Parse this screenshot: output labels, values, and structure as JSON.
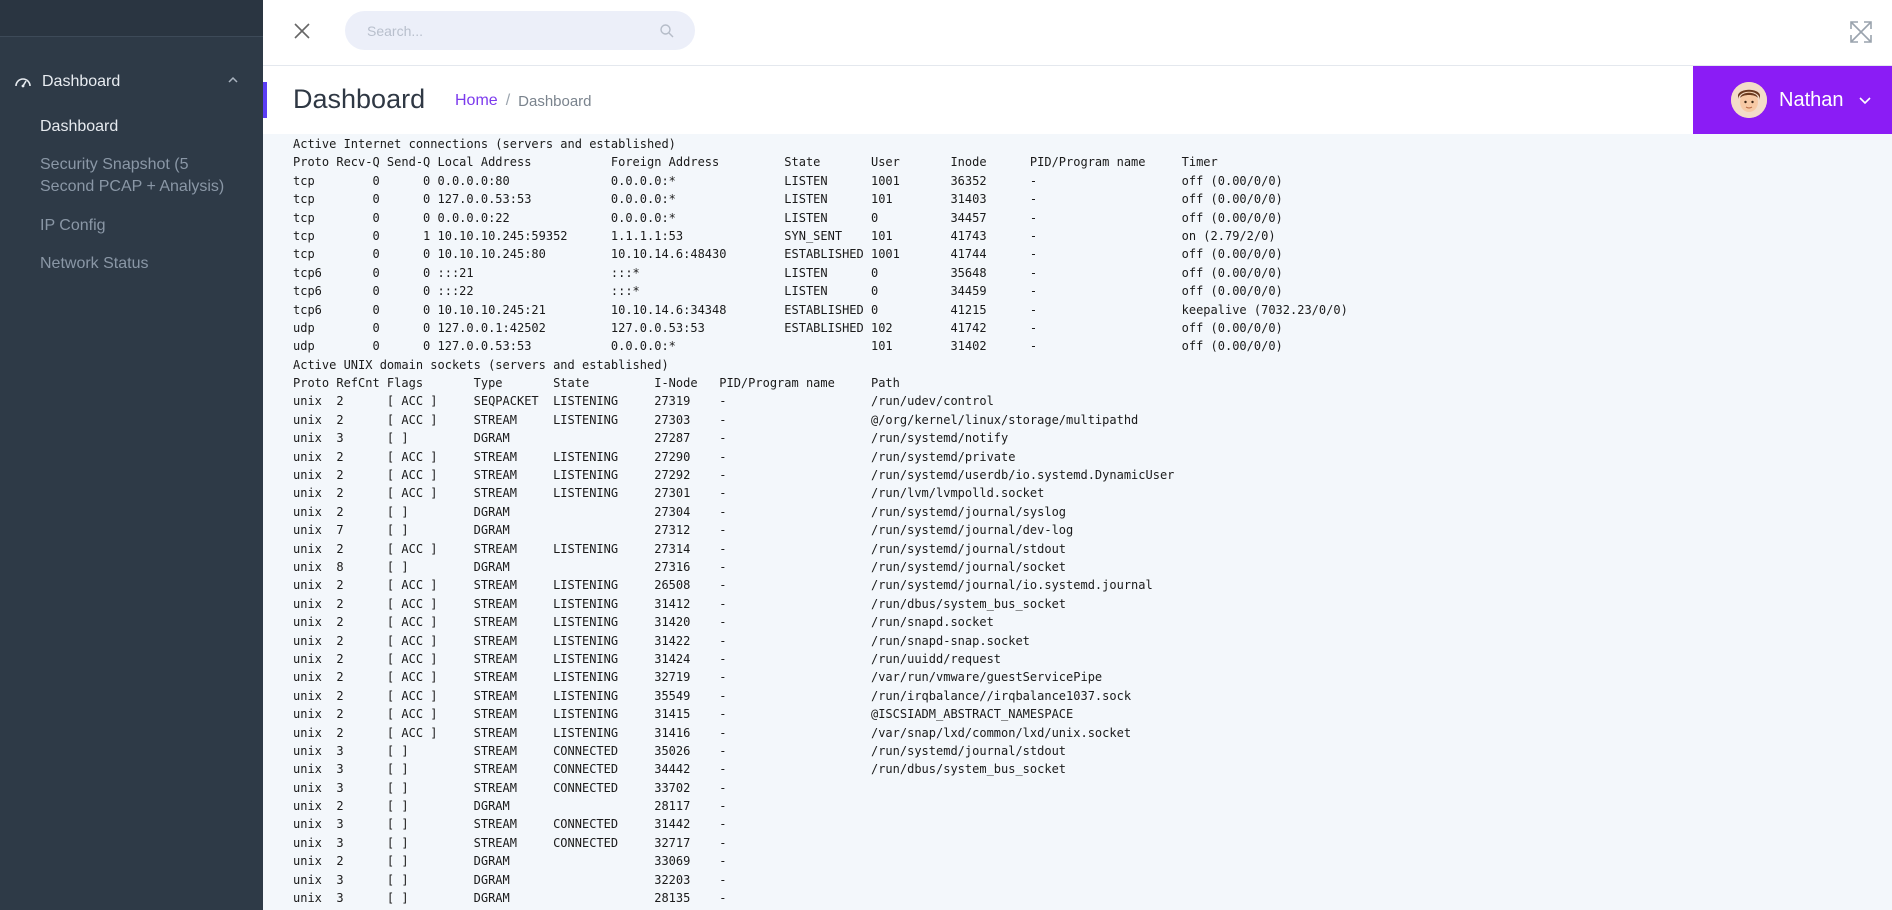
{
  "sidebar": {
    "group_label": "Dashboard",
    "items": [
      {
        "label": "Dashboard"
      },
      {
        "label": "Security Snapshot (5 Second PCAP + Analysis)"
      },
      {
        "label": "IP Config"
      },
      {
        "label": "Network Status"
      }
    ]
  },
  "header": {
    "search_placeholder": "Search..."
  },
  "page": {
    "title": "Dashboard",
    "breadcrumb": {
      "home": "Home",
      "separator": "/",
      "current": "Dashboard"
    }
  },
  "user": {
    "name": "Nathan"
  },
  "colors": {
    "accent": "#8b1cf5",
    "sidebar": "#2e3a47",
    "link": "#7c3aed"
  },
  "terminal_lines": [
    "Active Internet connections (servers and established)",
    "Proto Recv-Q Send-Q Local Address           Foreign Address         State       User       Inode      PID/Program name     Timer",
    "tcp        0      0 0.0.0.0:80              0.0.0.0:*               LISTEN      1001       36352      -                    off (0.00/0/0)",
    "tcp        0      0 127.0.0.53:53           0.0.0.0:*               LISTEN      101        31403      -                    off (0.00/0/0)",
    "tcp        0      0 0.0.0.0:22              0.0.0.0:*               LISTEN      0          34457      -                    off (0.00/0/0)",
    "tcp        0      1 10.10.10.245:59352      1.1.1.1:53              SYN_SENT    101        41743      -                    on (2.79/2/0)",
    "tcp        0      0 10.10.10.245:80         10.10.14.6:48430        ESTABLISHED 1001       41744      -                    off (0.00/0/0)",
    "tcp6       0      0 :::21                   :::*                    LISTEN      0          35648      -                    off (0.00/0/0)",
    "tcp6       0      0 :::22                   :::*                    LISTEN      0          34459      -                    off (0.00/0/0)",
    "tcp6       0      0 10.10.10.245:21         10.10.14.6:34348        ESTABLISHED 0          41215      -                    keepalive (7032.23/0/0)",
    "udp        0      0 127.0.0.1:42502         127.0.0.53:53           ESTABLISHED 102        41742      -                    off (0.00/0/0)",
    "udp        0      0 127.0.0.53:53           0.0.0.0:*                           101        31402      -                    off (0.00/0/0)",
    "Active UNIX domain sockets (servers and established)",
    "Proto RefCnt Flags       Type       State         I-Node   PID/Program name     Path",
    "unix  2      [ ACC ]     SEQPACKET  LISTENING     27319    -                    /run/udev/control",
    "unix  2      [ ACC ]     STREAM     LISTENING     27303    -                    @/org/kernel/linux/storage/multipathd",
    "unix  3      [ ]         DGRAM                    27287    -                    /run/systemd/notify",
    "unix  2      [ ACC ]     STREAM     LISTENING     27290    -                    /run/systemd/private",
    "unix  2      [ ACC ]     STREAM     LISTENING     27292    -                    /run/systemd/userdb/io.systemd.DynamicUser",
    "unix  2      [ ACC ]     STREAM     LISTENING     27301    -                    /run/lvm/lvmpolld.socket",
    "unix  2      [ ]         DGRAM                    27304    -                    /run/systemd/journal/syslog",
    "unix  7      [ ]         DGRAM                    27312    -                    /run/systemd/journal/dev-log",
    "unix  2      [ ACC ]     STREAM     LISTENING     27314    -                    /run/systemd/journal/stdout",
    "unix  8      [ ]         DGRAM                    27316    -                    /run/systemd/journal/socket",
    "unix  2      [ ACC ]     STREAM     LISTENING     26508    -                    /run/systemd/journal/io.systemd.journal",
    "unix  2      [ ACC ]     STREAM     LISTENING     31412    -                    /run/dbus/system_bus_socket",
    "unix  2      [ ACC ]     STREAM     LISTENING     31420    -                    /run/snapd.socket",
    "unix  2      [ ACC ]     STREAM     LISTENING     31422    -                    /run/snapd-snap.socket",
    "unix  2      [ ACC ]     STREAM     LISTENING     31424    -                    /run/uuidd/request",
    "unix  2      [ ACC ]     STREAM     LISTENING     32719    -                    /var/run/vmware/guestServicePipe",
    "unix  2      [ ACC ]     STREAM     LISTENING     35549    -                    /run/irqbalance//irqbalance1037.sock",
    "unix  2      [ ACC ]     STREAM     LISTENING     31415    -                    @ISCSIADM_ABSTRACT_NAMESPACE",
    "unix  2      [ ACC ]     STREAM     LISTENING     31416    -                    /var/snap/lxd/common/lxd/unix.socket",
    "unix  3      [ ]         STREAM     CONNECTED     35026    -                    /run/systemd/journal/stdout",
    "unix  3      [ ]         STREAM     CONNECTED     34442    -                    /run/dbus/system_bus_socket",
    "unix  3      [ ]         STREAM     CONNECTED     33702    -",
    "unix  2      [ ]         DGRAM                    28117    -",
    "unix  3      [ ]         STREAM     CONNECTED     31442    -",
    "unix  3      [ ]         STREAM     CONNECTED     32717    -",
    "unix  2      [ ]         DGRAM                    33069    -",
    "unix  3      [ ]         DGRAM                    32203    -",
    "unix  3      [ ]         DGRAM                    28135    -"
  ]
}
